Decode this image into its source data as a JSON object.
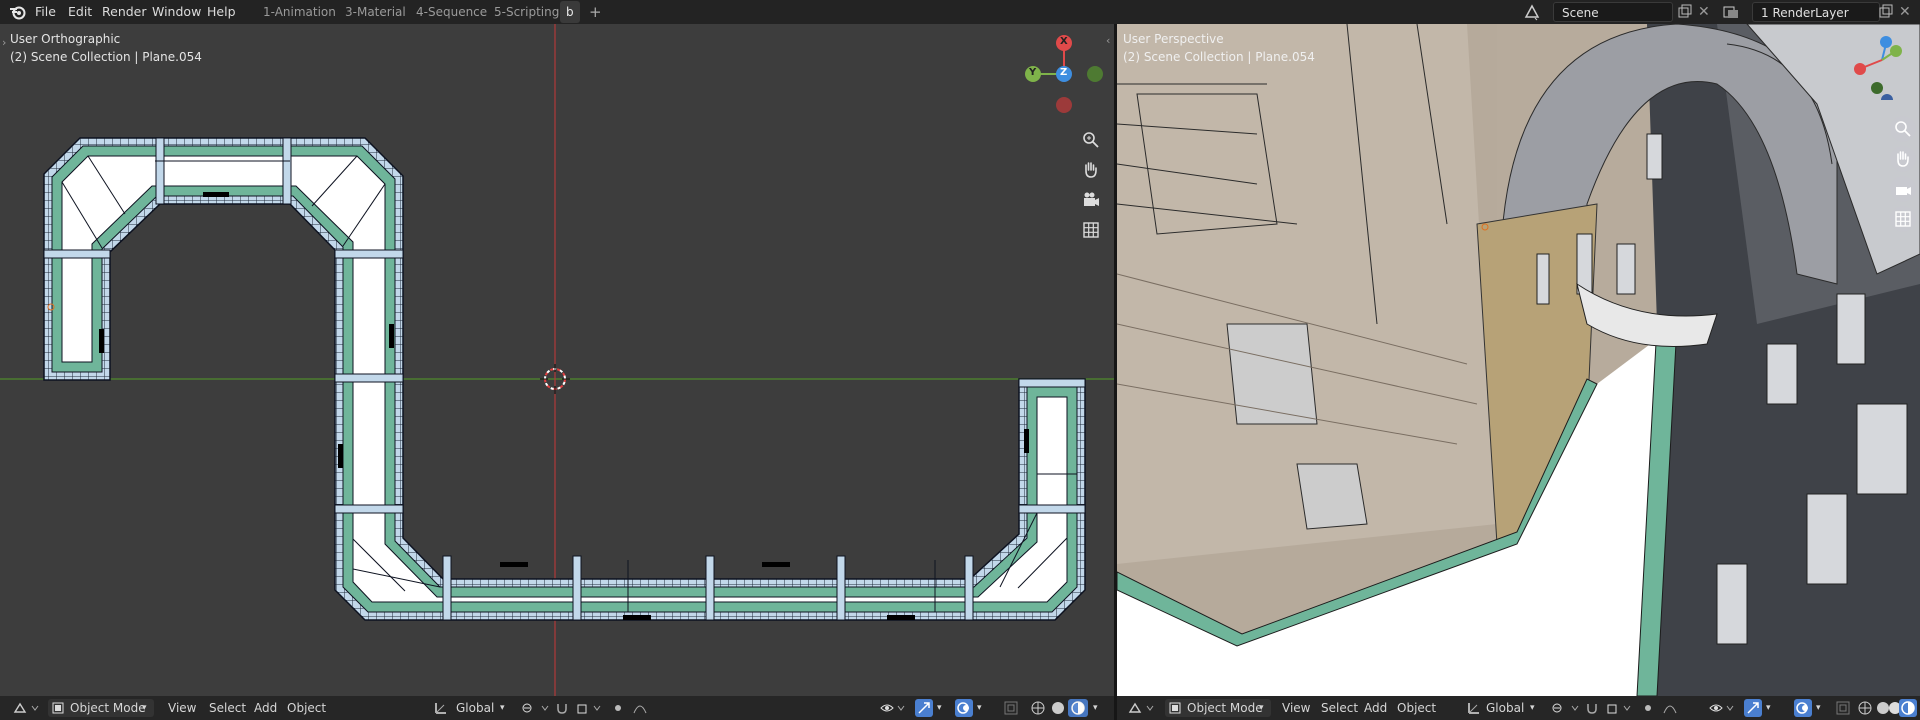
{
  "topbar": {
    "menu": [
      "File",
      "Edit",
      "Render",
      "Window",
      "Help"
    ],
    "workspace_tabs": [
      "1-Animation",
      "3-Material",
      "4-Sequence",
      "5-Scripting",
      "b"
    ],
    "active_tab": "b",
    "add_tab": "+",
    "scene_name": "Scene",
    "view_layer": "1 RenderLayer"
  },
  "left_viewport": {
    "view_name": "User Orthographic",
    "collection_info": "(2) Scene Collection | Plane.054",
    "gizmo": {
      "x": "X",
      "y": "Y",
      "z": "Z"
    }
  },
  "right_viewport": {
    "view_name": "User Perspective",
    "collection_info": "(2) Scene Collection | Plane.054"
  },
  "header_left": {
    "mode": "Object Mode",
    "menus": [
      "View",
      "Select",
      "Add",
      "Object"
    ],
    "orientation": "Global"
  },
  "header_right": {
    "mode": "Object Mode",
    "menus": [
      "View",
      "Select",
      "Add",
      "Object"
    ],
    "orientation": "Global"
  },
  "colors": {
    "viewport_bg": "#3d3d3d",
    "mesh_fill": "#ffffff",
    "mesh_trim": "#6fb59a",
    "mesh_edge_tile": "#bcd6ea",
    "axis_x": "#c0392b",
    "axis_y": "#4f8a2c",
    "gizmo_x": "#e04a4a",
    "gizmo_y": "#7fb34a",
    "gizmo_z": "#3e8ee0",
    "accent_blue": "#4a7fd0"
  }
}
